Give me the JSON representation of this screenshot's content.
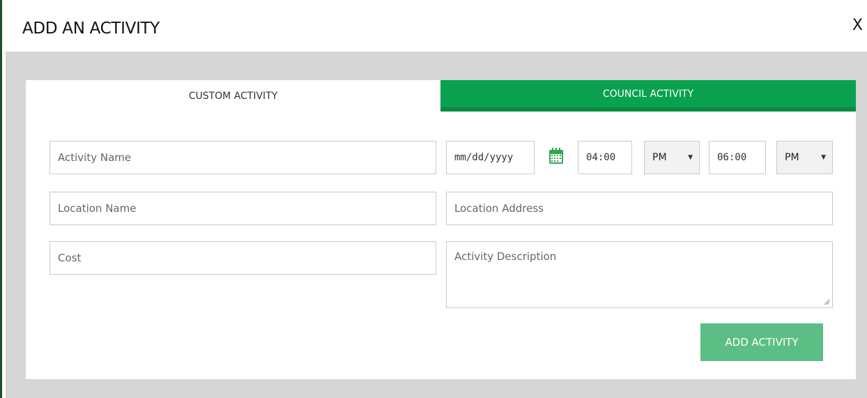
{
  "modal": {
    "title": "ADD AN ACTIVITY",
    "close_label": "X"
  },
  "tabs": [
    {
      "label": "CUSTOM ACTIVITY",
      "active": true
    },
    {
      "label": "COUNCIL ACTIVITY",
      "active": false
    }
  ],
  "form": {
    "activity_name_placeholder": "Activity Name",
    "location_name_placeholder": "Location Name",
    "cost_placeholder": "Cost",
    "date_placeholder": "mm/dd/yyyy",
    "start_time": "04:00",
    "start_period": "PM",
    "end_time": "06:00",
    "end_period": "PM",
    "location_address_placeholder": "Location Address",
    "description_placeholder": "Activity Description",
    "submit_label": "ADD ACTIVITY"
  },
  "icons": {
    "calendar": "calendar-icon",
    "select_caret": "caret-down-icon",
    "resize": "resize-grip-icon"
  },
  "colors": {
    "tab_active_green": "#0aa14f",
    "button_green": "#5cbe85",
    "calendar_green": "#2fa84f",
    "backdrop_gray": "#d6d6d6"
  }
}
